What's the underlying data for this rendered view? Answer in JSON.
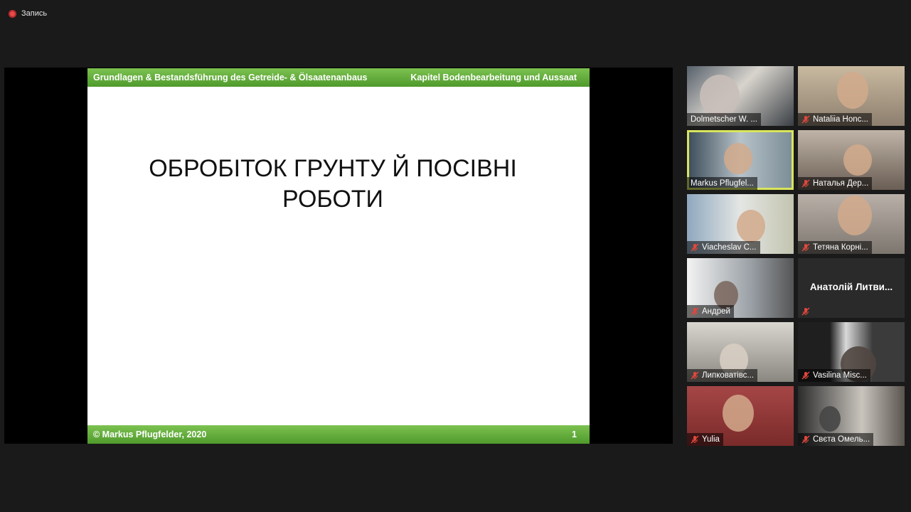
{
  "recording": {
    "label": "Запись",
    "dot_color": "#e84a4a"
  },
  "slide": {
    "header_left": "Grundlagen & Bestandsführung des Getreide- & Ölsaatenanbaus",
    "header_right": "Kapitel Bodenbearbeitung und Aussaat",
    "title_line1": "ОБРОБІТОК ГРУНТУ Й ПОСІВНІ",
    "title_line2": "РОБОТИ",
    "footer_left": "© Markus Pflugfelder, 2020",
    "page_number": "1",
    "accent_color": "#5aa832"
  },
  "participants": [
    {
      "name": "Dolmetscher W. ...",
      "muted": false,
      "video": true,
      "active": false
    },
    {
      "name": "Nataliia Honc...",
      "muted": true,
      "video": true,
      "active": false
    },
    {
      "name": "Markus Pflugfel...",
      "muted": false,
      "video": true,
      "active": true
    },
    {
      "name": "Наталья Дер...",
      "muted": true,
      "video": true,
      "active": false
    },
    {
      "name": "Viacheslav C...",
      "muted": true,
      "video": true,
      "active": false
    },
    {
      "name": "Тетяна Корні...",
      "muted": true,
      "video": true,
      "active": false
    },
    {
      "name": "Андрей",
      "muted": true,
      "video": true,
      "active": false
    },
    {
      "name": "Анатолій Литви...",
      "muted": true,
      "video": false,
      "active": false
    },
    {
      "name": "Липковатівс...",
      "muted": true,
      "video": true,
      "active": false
    },
    {
      "name": "Vasilina Misc...",
      "muted": true,
      "video": true,
      "active": false
    },
    {
      "name": "Yulia",
      "muted": true,
      "video": true,
      "active": false
    },
    {
      "name": "Свєта Омель...",
      "muted": true,
      "video": true,
      "active": false
    }
  ],
  "colors": {
    "active_speaker": "#d9e65c",
    "muted_icon": "#e0473d"
  }
}
